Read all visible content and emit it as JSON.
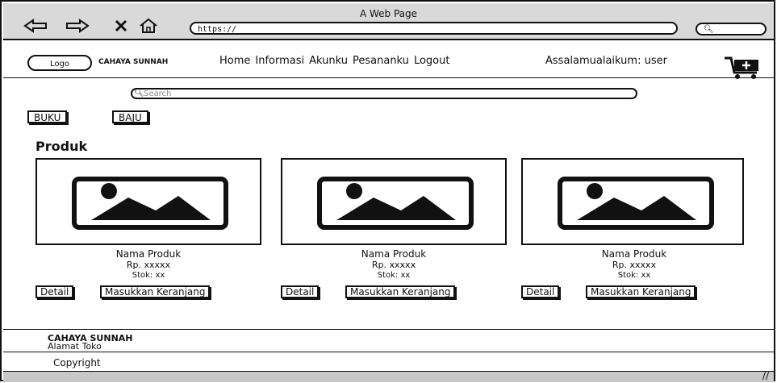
{
  "browser": {
    "title": "A Web Page",
    "url": "https://",
    "icons": [
      "back-arrow-icon",
      "forward-arrow-icon",
      "close-icon",
      "home-icon"
    ]
  },
  "nav": {
    "logo": "Logo",
    "brand": "CAHAYA SUNNAH",
    "menu": [
      "Home",
      "Informasi",
      "Akunku",
      "Pesananku",
      "Logout"
    ],
    "greeting": "Assalamualaikum: user"
  },
  "search": {
    "placeholder": "Search"
  },
  "categories": [
    "BUKU",
    "BAJU"
  ],
  "section_title": "Produk",
  "products": [
    {
      "name": "Nama Produk",
      "price": "Rp. xxxxx",
      "stock": "Stok: xx",
      "detail": "Detail",
      "add": "Masukkan Keranjang"
    },
    {
      "name": "Nama Produk",
      "price": "Rp. xxxxx",
      "stock": "Stok: xx",
      "detail": "Detail",
      "add": "Masukkan Keranjang"
    },
    {
      "name": "Nama Produk",
      "price": "Rp. xxxxx",
      "stock": "Stok: xx",
      "detail": "Detail",
      "add": "Masukkan Keranjang"
    }
  ],
  "footer": {
    "brand": "CAHAYA SUNNAH",
    "address": "Alamat Toko",
    "copyright": "Copyright"
  }
}
